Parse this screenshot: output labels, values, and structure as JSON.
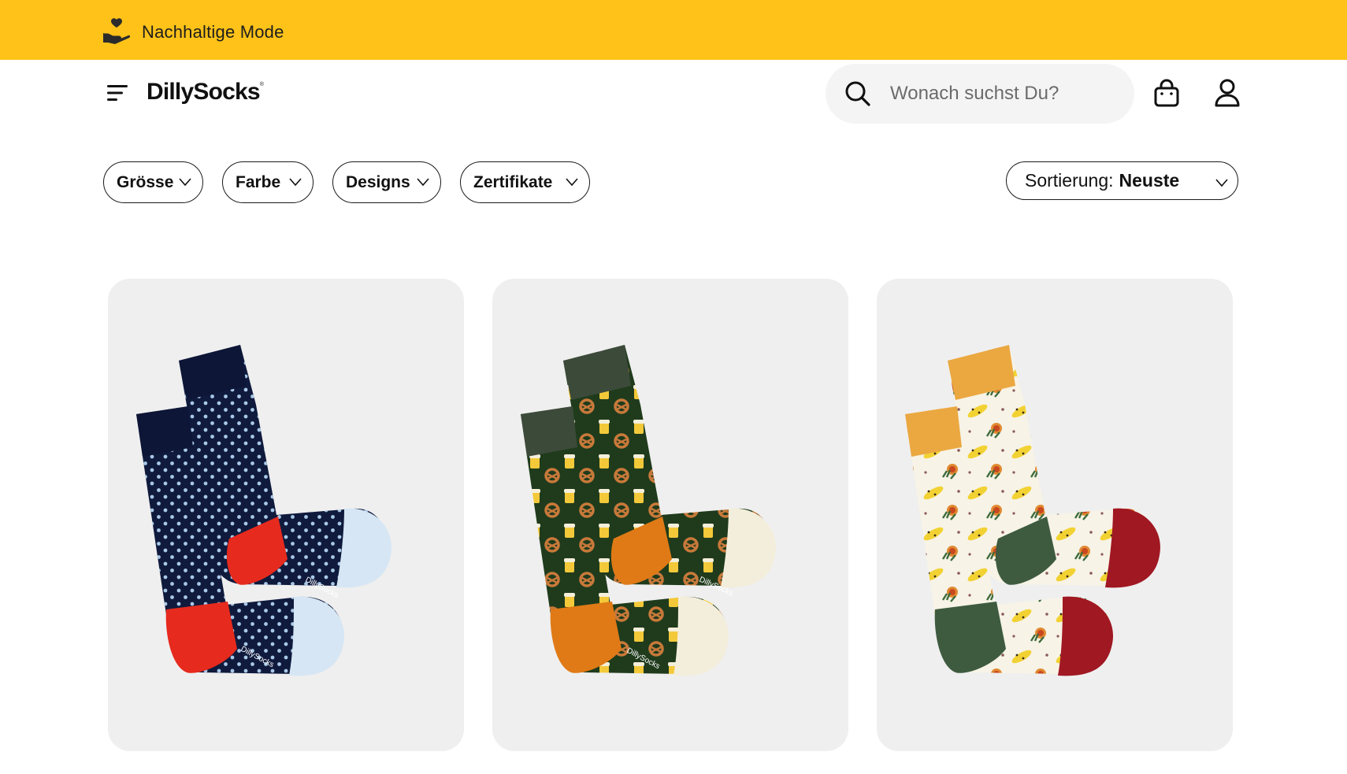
{
  "banner": {
    "text": "Nachhaltige Mode",
    "icon": "hand-heart-icon",
    "background": "#fec219"
  },
  "header": {
    "menu_icon": "menu-icon",
    "logo": "DillySocks",
    "logo_mark": "®",
    "search": {
      "placeholder": "Wonach suchst Du?",
      "value": "",
      "icon": "search-icon"
    },
    "cart_icon": "shopping-bag-icon",
    "account_icon": "user-icon"
  },
  "filters": [
    {
      "label": "Grösse"
    },
    {
      "label": "Farbe"
    },
    {
      "label": "Designs"
    },
    {
      "label": "Zertifikate"
    }
  ],
  "sort": {
    "label": "Sortierung:",
    "value": "Neuste"
  },
  "products": [
    {
      "design": "navy-polka-dot-socks",
      "colors": {
        "body": "#0f1a3d",
        "dots": "#a9c8e8",
        "heel": "#e62a1e",
        "toe": "#d6e6f4"
      },
      "brand_print": "DillySocks"
    },
    {
      "design": "pretzel-beer-socks",
      "colors": {
        "body": "#1f3b1c",
        "cuff": "#3c4a3a",
        "heel": "#e07a16",
        "toe": "#f3eedc"
      },
      "brand_print": "DillySocks"
    },
    {
      "design": "leopard-lion-socks",
      "colors": {
        "body": "#f7f3e6",
        "cuff": "#eba841",
        "heel": "#a01822",
        "toe": "#3e5b3f"
      },
      "brand_print": ""
    }
  ]
}
